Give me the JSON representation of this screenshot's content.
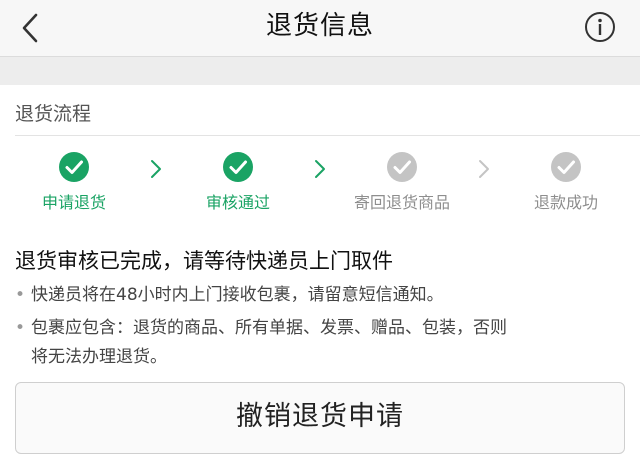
{
  "header": {
    "title": "退货信息"
  },
  "flow": {
    "title": "退货流程",
    "steps": [
      {
        "label": "申请退货",
        "status": "done"
      },
      {
        "label": "审核通过",
        "status": "done"
      },
      {
        "label": "寄回退货商品",
        "status": "pending"
      },
      {
        "label": "退款成功",
        "status": "pending"
      }
    ]
  },
  "status": {
    "title": "退货审核已完成，请等待快递员上门取件",
    "notes": [
      "快递员将在48小时内上门接收包裹，请留意短信通知。",
      "包裹应包含：退货的商品、所有单据、发票、赠品、包装，否则",
      "将无法办理退货。"
    ]
  },
  "actions": {
    "cancel_label": "撤销退货申请"
  },
  "colors": {
    "done": "#1aa364",
    "pending": "#c4c4c4",
    "background": "#f4f4f4"
  },
  "icons": {
    "back": "chevron-left-icon",
    "info": "info-icon",
    "step_done": "check-circle-icon",
    "step_pending": "check-circle-gray-icon",
    "separator": "chevron-right-icon"
  }
}
